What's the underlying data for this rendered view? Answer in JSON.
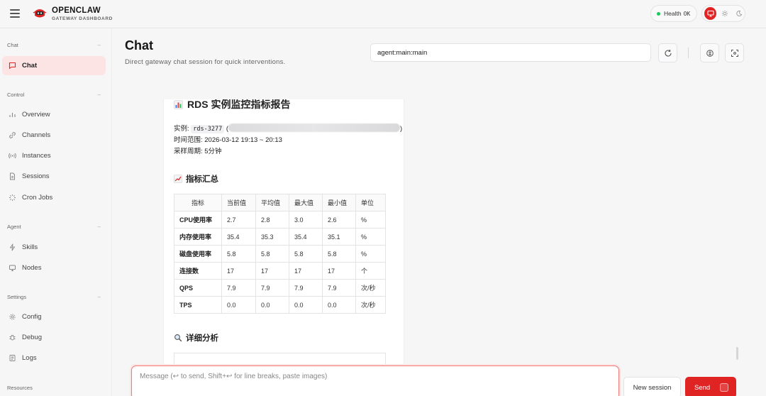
{
  "header": {
    "brand_name": "OPENCLAW",
    "brand_sub": "GATEWAY DASHBOARD",
    "health_label": "Health",
    "health_status": "OK",
    "health_color": "#22c55e",
    "accent": "#e02424"
  },
  "sidebar": {
    "sections": {
      "chat": "Chat",
      "control": "Control",
      "agent": "Agent",
      "settings": "Settings",
      "resources": "Resources"
    },
    "items": {
      "chat": "Chat",
      "overview": "Overview",
      "channels": "Channels",
      "instances": "Instances",
      "sessions": "Sessions",
      "cron_jobs": "Cron Jobs",
      "skills": "Skills",
      "nodes": "Nodes",
      "config": "Config",
      "debug": "Debug",
      "logs": "Logs"
    }
  },
  "main": {
    "title": "Chat",
    "subtitle": "Direct gateway chat session for quick interventions.",
    "session_key": "agent:main:main"
  },
  "message": {
    "report_title": "RDS 实例监控指标报告",
    "instance_label": "实例: ",
    "instance_id": "rds-3277",
    "instance_paren_open": " (",
    "instance_paren_close": ")",
    "time_range": "时间范围: 2026-03-12 19:13 ~ 20:13",
    "sample_period": "采样周期: 5分钟",
    "summary_heading": "指标汇总",
    "detail_heading": "详细分析",
    "table_headers": [
      "指标",
      "当前值",
      "平均值",
      "最大值",
      "最小值",
      "单位"
    ],
    "table_rows": [
      [
        "CPU使用率",
        "2.7",
        "2.8",
        "3.0",
        "2.6",
        "%"
      ],
      [
        "内存使用率",
        "35.4",
        "35.3",
        "35.4",
        "35.1",
        "%"
      ],
      [
        "磁盘使用率",
        "5.8",
        "5.8",
        "5.8",
        "5.8",
        "%"
      ],
      [
        "连接数",
        "17",
        "17",
        "17",
        "17",
        "个"
      ],
      [
        "QPS",
        "7.9",
        "7.9",
        "7.9",
        "7.9",
        "次/秒"
      ],
      [
        "TPS",
        "0.0",
        "0.0",
        "0.0",
        "0.0",
        "次/秒"
      ]
    ]
  },
  "composer": {
    "placeholder": "Message (↩ to send, Shift+↩ for line breaks, paste images)",
    "new_session": "New session",
    "send": "Send"
  }
}
